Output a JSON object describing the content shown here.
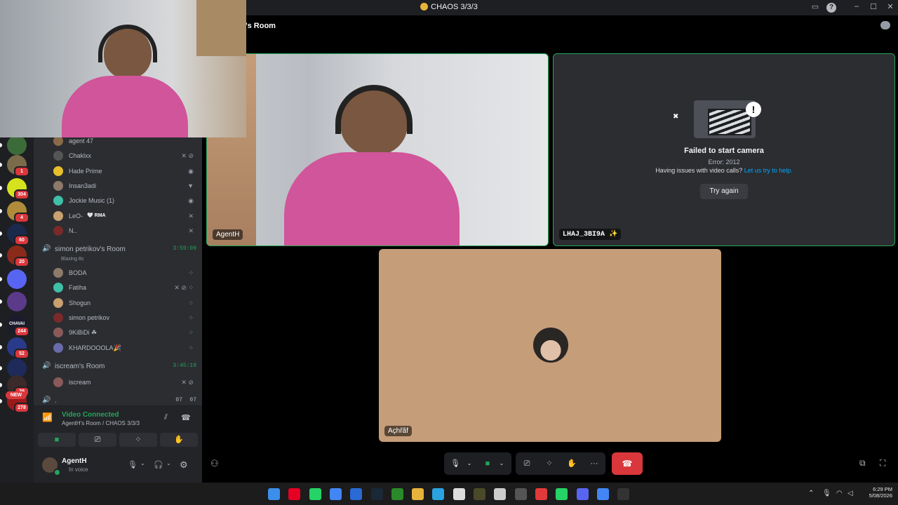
{
  "window": {
    "title": "CHAOS 3/3/3"
  },
  "header": {
    "room_title": "'s Room"
  },
  "servers": [
    {
      "badge": ""
    },
    {
      "badge": "1"
    },
    {
      "badge": "304"
    },
    {
      "badge": "4"
    },
    {
      "badge": "60"
    },
    {
      "badge": "20"
    },
    {
      "badge": ""
    },
    {
      "badge": ""
    },
    {
      "badge": "244"
    },
    {
      "badge": "52"
    },
    {
      "badge": ""
    },
    {
      "badge": "29"
    },
    {
      "badge": "278"
    }
  ],
  "server_labels": {
    "chavai": "CHAVAI",
    "new": "NEW"
  },
  "members_room1": [
    {
      "name": "agent 47",
      "icons": ""
    },
    {
      "name": "Chaklxx",
      "icons": "✕ ⊘"
    },
    {
      "name": "Hade Prime",
      "icons": "◉"
    },
    {
      "name": "Insan3adi",
      "icons": "▼"
    },
    {
      "name": "Jockie Music (1)",
      "icons": "◉"
    },
    {
      "name": "LeO-",
      "tag": "🤍 RMA",
      "icons": "✕"
    },
    {
      "name": "N..",
      "icons": "✕"
    }
  ],
  "room2": {
    "name": "simon petrikov's Room",
    "time": "3:59:09",
    "status": "Blazing 8s"
  },
  "members_room2": [
    {
      "name": "BODA",
      "icons": "⁘"
    },
    {
      "name": "Fatiha",
      "icons": "✕ ⊘ ⁘"
    },
    {
      "name": "Shogun",
      "icons": "⁘"
    },
    {
      "name": "simon petrikov",
      "icons": "⁘"
    },
    {
      "name": "9KiBiDi ☘",
      "icons": "⁘"
    },
    {
      "name": "KHARDOOOLA🎉",
      "icons": "⁘"
    }
  ],
  "room3": {
    "name": "iscream's Room",
    "time": "3:45:19"
  },
  "members_room3": [
    {
      "name": "iscream",
      "icons": "✕ ⊘"
    }
  ],
  "room4": {
    "name": ".",
    "count_a": "07",
    "count_b": "07"
  },
  "voice_panel": {
    "status": "Video Connected",
    "location": "AgentH's Room / CHAOS 3/3/3"
  },
  "user": {
    "name": "AgentH",
    "status": "In voice"
  },
  "tiles": {
    "self": {
      "name": "AgentH"
    },
    "failed": {
      "name": "LHAJ_3BI9A ✨",
      "heading": "Failed to start camera",
      "error": "Error: 2012",
      "help_text": "Having issues with video calls?",
      "help_link": "Let us try to help.",
      "retry_label": "Try again"
    },
    "audio": {
      "name": "Açhřãf",
      "bg_color": "#c59d79"
    }
  },
  "colors": {
    "accent_green": "#23a55a",
    "hangup_red": "#da373c",
    "link_blue": "#00a8fc"
  },
  "clock": {
    "time": "6:29 PM",
    "date": "5/08/2026"
  }
}
